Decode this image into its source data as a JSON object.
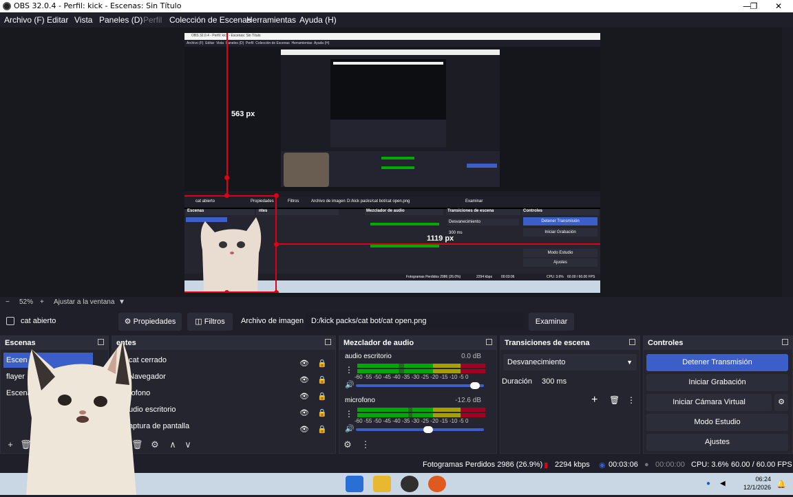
{
  "window": {
    "title": "OBS 32.0.4 - Perfil: kick - Escenas: Sin Título"
  },
  "menu": [
    "Archivo (F)",
    "Editar",
    "Vista",
    "Paneles (D)",
    "Perfil",
    "Colección de Escenas",
    "Herramientas",
    "Ayuda (H)"
  ],
  "preview": {
    "measure_vertical": "563 px",
    "measure_horizontal": "1119 px",
    "nested_title": "OBS 32.0.4 - Perfil: kick - Escenas: Sin Título",
    "nested_menu": "Archivo (F)  Editar  Vista  Paneles (D)  Perfil  Colección de Escenas  Herramientas  Ayuda (H)",
    "nested_source": "cat abierto",
    "nested_path": "D:/kick packs/cat bot/cat open.png",
    "nested_labels": {
      "props": "Propiedades",
      "filters": "Filtros",
      "image_file": "Archivo de imagen",
      "browse": "Examinar",
      "scenes": "Escenas",
      "sources": "ntes",
      "mixer": "Mezclador de audio",
      "transitions": "Transiciones de escena",
      "controls": "Controles",
      "stop_stream": "Detener Transmisión",
      "start_rec": "Iniciar Grabación",
      "studio": "Modo Estudio",
      "settings": "Ajustes",
      "fade": "Desvanecimiento",
      "duration": "Duración",
      "dur_val": "300 ms",
      "status": "Fotogramas Perdidos 2986 (26.0%)",
      "kbps": "2294 kbps",
      "time": "00:03:06",
      "cpu": "CPU: 3.6%",
      "fps": "60.00 / 60.00 FPS"
    }
  },
  "zoom": {
    "minus": "−",
    "value": "52%",
    "plus": "+",
    "fit": "Ajustar a la ventana"
  },
  "sourcebar": {
    "source_name": "cat abierto",
    "properties": "Propiedades",
    "filters": "Filtros",
    "image_file_label": "Archivo de imagen",
    "path": "D:/kick packs/cat bot/cat open.png",
    "browse": "Examinar"
  },
  "scenes": {
    "title": "Escenas",
    "items": [
      "Escen",
      "flayer",
      "Escena"
    ]
  },
  "sources": {
    "title": "entes",
    "items": [
      "cat cerrado",
      "Navegador",
      "rofono",
      "udio escritorio",
      "aptura de pantalla"
    ]
  },
  "mixer": {
    "title": "Mezclador de audio",
    "channels": [
      {
        "name": "audio escritorio",
        "db": "0.0 dB",
        "volume": 0.97
      },
      {
        "name": "microfono",
        "db": "-12.6 dB",
        "volume": 0.6
      }
    ],
    "ticks": "-60 -55 -50 -45 -40 -35 -30 -25 -20 -15 -10  -5  0"
  },
  "transitions": {
    "title": "Transiciones de escena",
    "selected": "Desvanecimiento",
    "duration_label": "Duración",
    "duration_value": "300 ms"
  },
  "controls": {
    "title": "Controles",
    "stop_stream": "Detener Transmisión",
    "start_record": "Iniciar Grabación",
    "virtual_cam": "Iniciar Cámara Virtual",
    "studio_mode": "Modo Estudio",
    "settings": "Ajustes"
  },
  "status": {
    "dropped": "Fotogramas Perdidos 2986 (26.9%)",
    "kbps": "2294 kbps",
    "stream_time": "00:03:06",
    "rec_time": "00:00:00",
    "cpu": "CPU: 3.6%",
    "fps": "60.00 / 60.00 FPS"
  },
  "taskbar": {
    "time": "06:24",
    "date": "12/1/2026"
  },
  "colors": {
    "accent": "#3b5ec9",
    "measure": "#e00016",
    "bg": "#1e1f29"
  }
}
